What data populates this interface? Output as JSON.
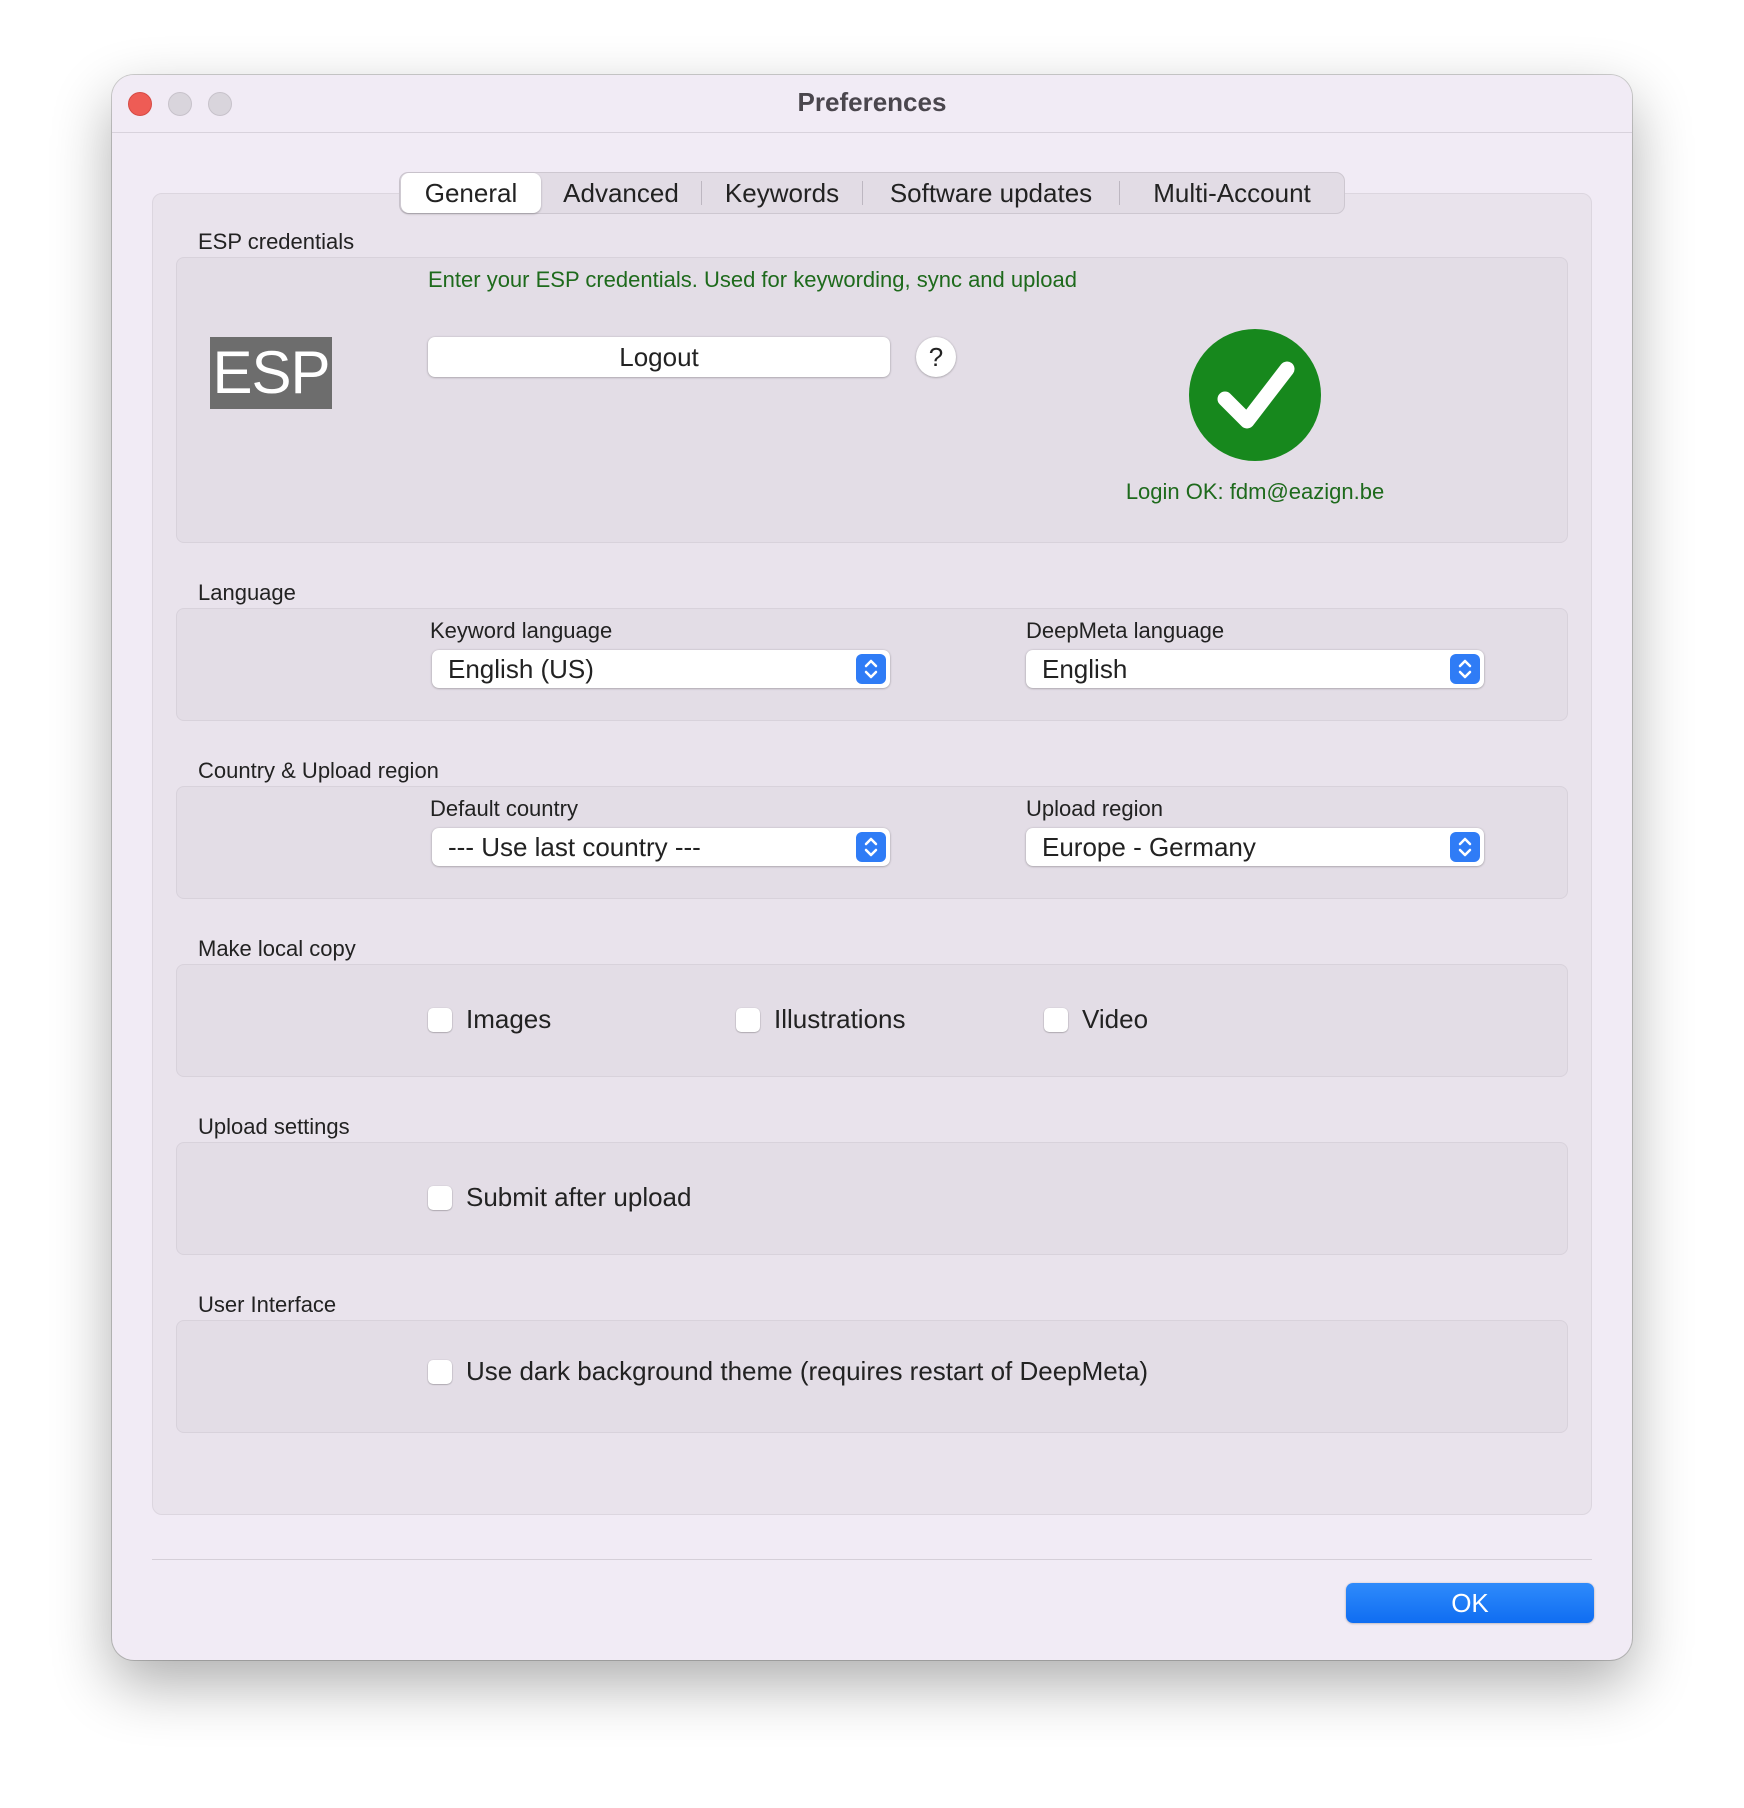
{
  "window": {
    "title": "Preferences"
  },
  "tabs": [
    {
      "label": "General",
      "selected": true
    },
    {
      "label": "Advanced",
      "selected": false
    },
    {
      "label": "Keywords",
      "selected": false
    },
    {
      "label": "Software updates",
      "selected": false
    },
    {
      "label": "Multi-Account",
      "selected": false
    }
  ],
  "esp": {
    "section_label": "ESP credentials",
    "logo_text": "ESP",
    "instructions": "Enter your ESP credentials. Used for keywording, sync and upload",
    "logout_label": "Logout",
    "help_label": "?",
    "status_icon": "checkmark-circle-icon",
    "status_color": "#17881d",
    "status_text": "Login OK: fdm@eazign.be"
  },
  "language": {
    "section_label": "Language",
    "keyword_label": "Keyword language",
    "keyword_value": "English (US)",
    "deepmeta_label": "DeepMeta language",
    "deepmeta_value": "English"
  },
  "country": {
    "section_label": "Country & Upload region",
    "default_label": "Default country",
    "default_value": "--- Use last country ---",
    "region_label": "Upload region",
    "region_value": "Europe - Germany"
  },
  "local_copy": {
    "section_label": "Make local copy",
    "images_label": "Images",
    "images_checked": false,
    "illustrations_label": "Illustrations",
    "illustrations_checked": false,
    "video_label": "Video",
    "video_checked": false
  },
  "upload_settings": {
    "section_label": "Upload settings",
    "submit_label": "Submit after upload",
    "submit_checked": false
  },
  "ui": {
    "section_label": "User Interface",
    "dark_label": "Use dark background theme (requires restart of DeepMeta)",
    "dark_checked": false
  },
  "footer": {
    "ok_label": "OK"
  },
  "colors": {
    "accent": "#1473f5",
    "instruction_text": "#1e6a1c"
  }
}
